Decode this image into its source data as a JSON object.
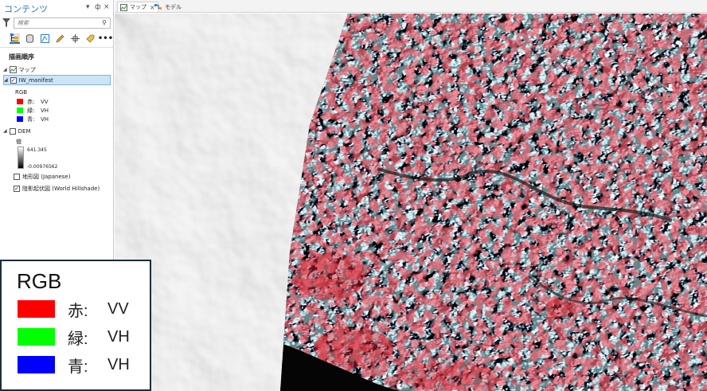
{
  "contents_pane": {
    "title": "コンテンツ",
    "pin_label": "ф",
    "close_label": "×",
    "search_placeholder": "検索",
    "draw_order_title": "描画順序",
    "map_item": "マップ",
    "layers": [
      {
        "name": "IW_manifest",
        "checked": true,
        "selected": true
      },
      {
        "name": "DEM",
        "checked": false
      },
      {
        "name": "地形図 (Japanese)",
        "checked": false
      },
      {
        "name": "陰影起伏図 (World Hillshade)",
        "checked": true
      }
    ],
    "rgb_label": "RGB",
    "rgb_bands": [
      {
        "channel": "赤:",
        "band": "VV",
        "color": "#ff0000"
      },
      {
        "channel": "緑:",
        "band": "VH",
        "color": "#00ff00"
      },
      {
        "channel": "青:",
        "band": "VH",
        "color": "#0000ff"
      }
    ],
    "dem_value_label": "値",
    "dem_max": "641.345",
    "dem_min": "-0.00976562"
  },
  "tabs": [
    {
      "label": "マップ",
      "active": true,
      "icon": "map-icon"
    },
    {
      "label": "モデル",
      "active": false,
      "icon": "model-icon"
    }
  ],
  "legend": {
    "title": "RGB",
    "rows": [
      {
        "label": "赤:",
        "value": "VV",
        "color": "#ff0000"
      },
      {
        "label": "緑:",
        "value": "VH",
        "color": "#00ff00"
      },
      {
        "label": "青:",
        "value": "VH",
        "color": "#0000ff"
      }
    ]
  },
  "colors": {
    "accent": "#1a73c8",
    "sar_red": "#e0202a",
    "sar_cyan": "#7fe0e8",
    "legend_border": "#1d2d3a"
  }
}
